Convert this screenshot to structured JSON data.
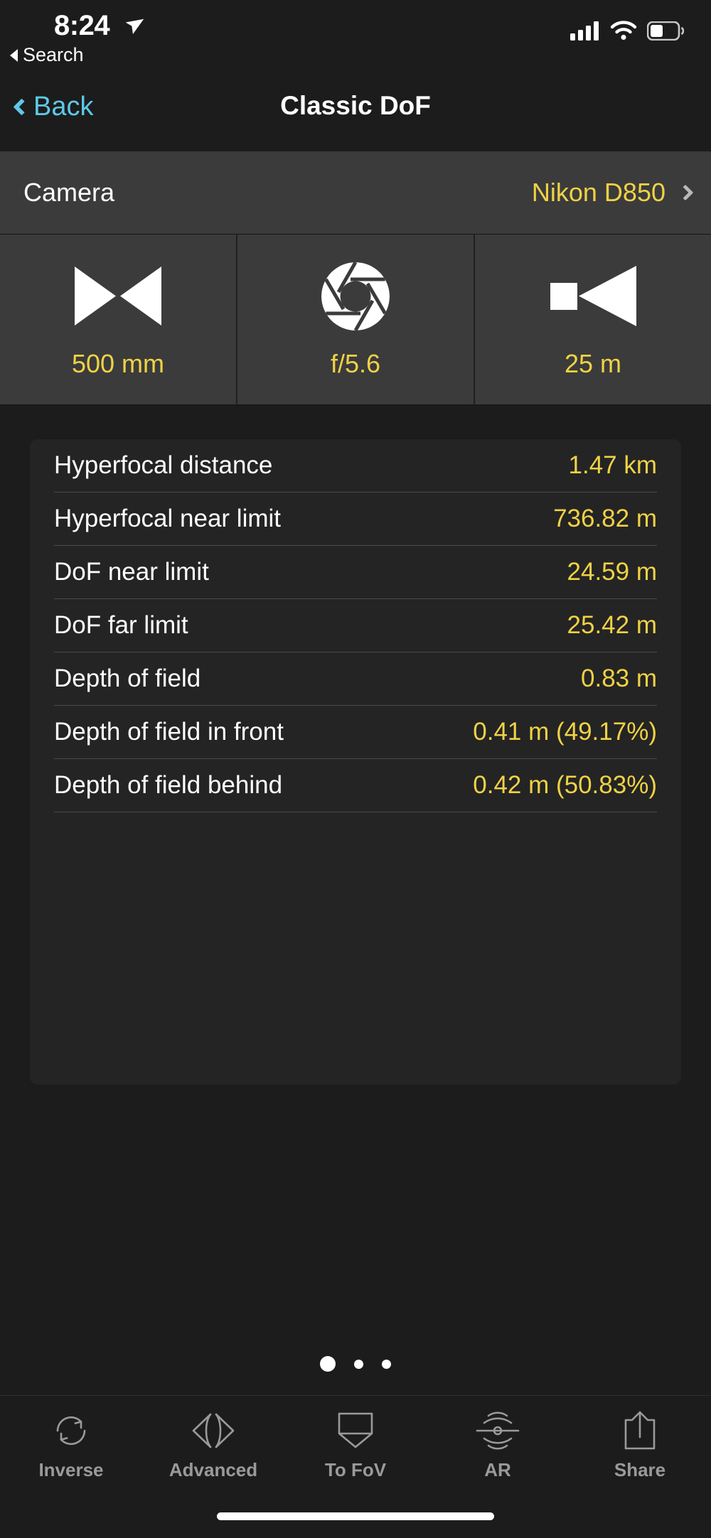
{
  "status_bar": {
    "time": "8:24",
    "location_icon": "location-arrow-icon",
    "return_label": "Search",
    "signal_icon": "cellular-signal-icon",
    "wifi_icon": "wifi-icon",
    "battery_icon": "battery-icon"
  },
  "nav_bar": {
    "back_label": "Back",
    "title": "Classic DoF",
    "back_color": "#5ec8e8"
  },
  "camera_row": {
    "label": "Camera",
    "value": "Nikon D850",
    "chevron_icon": "chevron-right-icon"
  },
  "params": [
    {
      "icon": "focal-length-icon",
      "value": "500 mm",
      "name": "focal-length"
    },
    {
      "icon": "aperture-iris-icon",
      "value": "f/5.6",
      "name": "aperture"
    },
    {
      "icon": "subject-distance-icon",
      "value": "25 m",
      "name": "subject-distance"
    }
  ],
  "results": [
    {
      "label": "Hyperfocal distance",
      "value": "1.47 km"
    },
    {
      "label": "Hyperfocal near limit",
      "value": "736.82 m"
    },
    {
      "label": "DoF near limit",
      "value": "24.59 m"
    },
    {
      "label": "DoF far limit",
      "value": "25.42 m"
    },
    {
      "label": "Depth of field",
      "value": "0.83 m"
    },
    {
      "label": "Depth of field in front",
      "value": "0.41 m (49.17%)"
    },
    {
      "label": "Depth of field behind",
      "value": "0.42 m (50.83%)"
    }
  ],
  "page_dots": {
    "count": 3,
    "active_index": 0
  },
  "tab_bar": [
    {
      "label": "Inverse",
      "icon": "inverse-refresh-icon"
    },
    {
      "label": "Advanced",
      "icon": "advanced-arrows-icon"
    },
    {
      "label": "To FoV",
      "icon": "to-fov-frame-icon"
    },
    {
      "label": "AR",
      "icon": "ar-waves-icon"
    },
    {
      "label": "Share",
      "icon": "share-upload-icon"
    }
  ],
  "colors": {
    "accent_yellow": "#f0d246",
    "link_blue": "#5ec8e8",
    "card_bg": "#242424",
    "page_bg": "#1c1c1c",
    "panel_bg": "#3b3b3b",
    "tab_inactive": "#9a9a9a"
  }
}
